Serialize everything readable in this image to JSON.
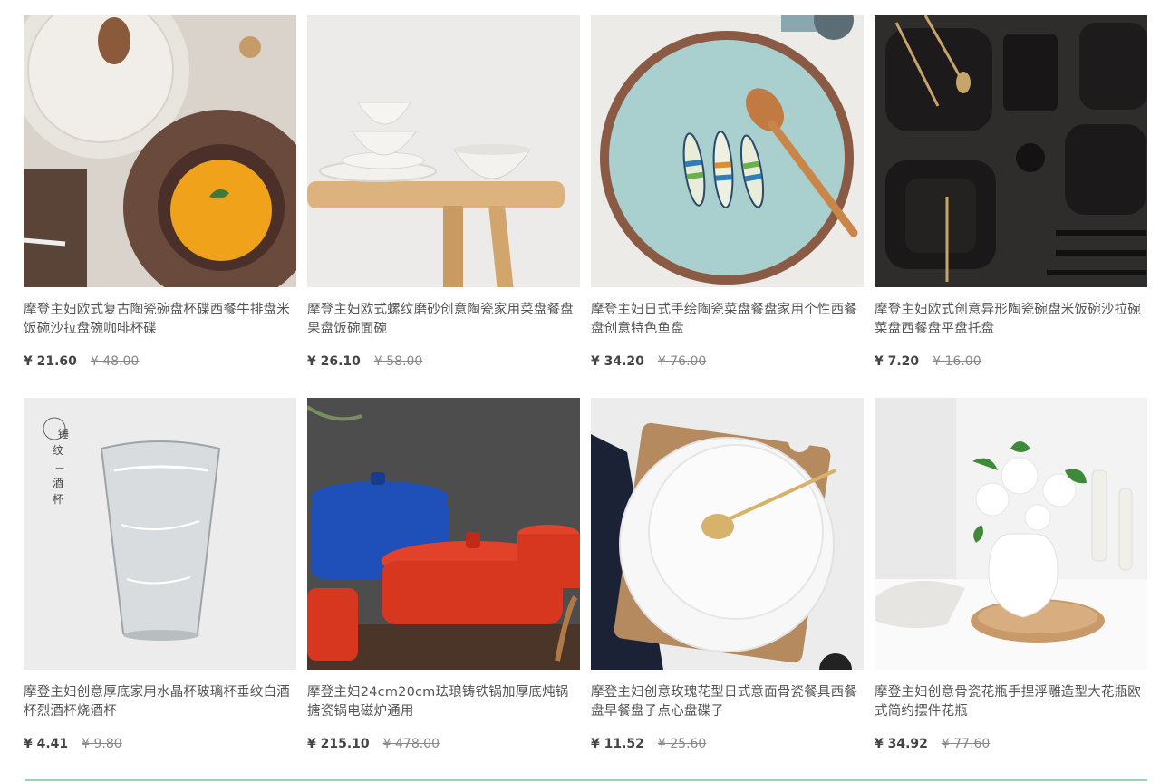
{
  "accent_line_color": "#9ad3b0",
  "products": [
    {
      "title": "摩登主妇欧式复古陶瓷碗盘杯碟西餐牛排盘米饭碗沙拉盘碗咖啡杯碟",
      "price": "¥ 21.60",
      "original_price": "¥ 48.00",
      "image_icon": "bowl-soup-image"
    },
    {
      "title": "摩登主妇欧式螺纹磨砂创意陶瓷家用菜盘餐盘果盘饭碗面碗",
      "price": "¥ 26.10",
      "original_price": "¥ 58.00",
      "image_icon": "bowls-on-table-image"
    },
    {
      "title": "摩登主妇日式手绘陶瓷菜盘餐盘家用个性西餐盘创意特色鱼盘",
      "price": "¥ 34.20",
      "original_price": "¥ 76.00",
      "image_icon": "fish-plate-image"
    },
    {
      "title": "摩登主妇欧式创意异形陶瓷碗盘米饭碗沙拉碗菜盘西餐盘平盘托盘",
      "price": "¥ 7.20",
      "original_price": "¥ 16.00",
      "image_icon": "black-dinnerware-image"
    },
    {
      "title": "摩登主妇创意厚底家用水晶杯玻璃杯垂纹白酒杯烈酒杯烧酒杯",
      "price": "¥ 4.41",
      "original_price": "¥ 9.80",
      "image_icon": "glass-cup-image",
      "image_caption": [
        "锤",
        "纹",
        "—",
        "酒",
        "杯"
      ]
    },
    {
      "title": "摩登主妇24cm20cm珐琅铸铁锅加厚底炖锅搪瓷锅电磁炉通用",
      "price": "¥ 215.10",
      "original_price": "¥ 478.00",
      "image_icon": "enamel-pots-image"
    },
    {
      "title": "摩登主妇创意玫瑰花型日式意面骨瓷餐具西餐盘早餐盘子点心盘碟子",
      "price": "¥ 11.52",
      "original_price": "¥ 25.60",
      "image_icon": "white-plates-image"
    },
    {
      "title": "摩登主妇创意骨瓷花瓶手捏浮雕造型大花瓶欧式简约摆件花瓶",
      "price": "¥ 34.92",
      "original_price": "¥ 77.60",
      "image_icon": "flower-vase-image"
    }
  ]
}
